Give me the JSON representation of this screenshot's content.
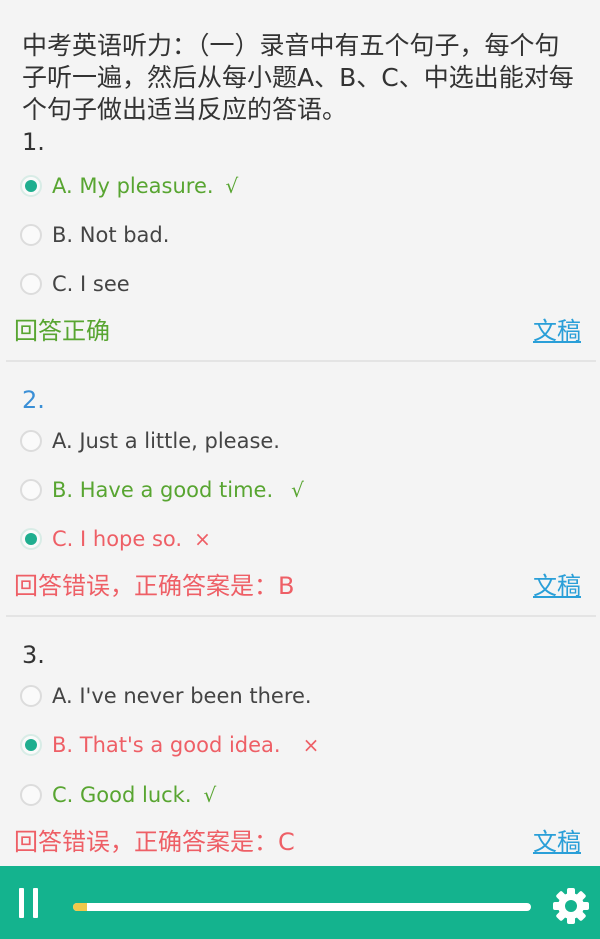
{
  "intro": "中考英语听力：（一）录音中有五个句子，每个句子听一遍，然后从每小题A、B、C、中选出能对每个句子做出适当反应的答语。",
  "questions": [
    {
      "number": "1.",
      "options": [
        {
          "text": "A. My pleasure.",
          "mark": "√",
          "status": "correct",
          "selected": true
        },
        {
          "text": "B. Not bad.",
          "mark": "",
          "status": "normal",
          "selected": false
        },
        {
          "text": "C. I see",
          "mark": "",
          "status": "normal",
          "selected": false
        }
      ],
      "result": "回答正确",
      "result_status": "correct",
      "script_link": "文稿"
    },
    {
      "number": "2.",
      "options": [
        {
          "text": "A. Just a little, please.",
          "mark": "",
          "status": "normal",
          "selected": false
        },
        {
          "text": "B. Have a good time.",
          "mark": "√",
          "status": "correct",
          "selected": false
        },
        {
          "text": "C. I hope so.",
          "mark": "×",
          "status": "wrong",
          "selected": true
        }
      ],
      "result": "回答错误，正确答案是：B",
      "result_status": "wrong",
      "script_link": "文稿"
    },
    {
      "number": "3.",
      "options": [
        {
          "text": "A. I've never been there.",
          "mark": "",
          "status": "normal",
          "selected": false
        },
        {
          "text": "B. That's a good idea.",
          "mark": "×",
          "status": "wrong",
          "selected": true
        },
        {
          "text": "C. Good luck.",
          "mark": "√",
          "status": "correct",
          "selected": false
        }
      ],
      "result": "回答错误，正确答案是：C",
      "result_status": "wrong",
      "script_link": "文稿"
    }
  ],
  "player": {
    "play_state_icon": "pause-icon",
    "settings_icon": "gear-icon",
    "progress": 0.03
  },
  "colors": {
    "accent": "#14b38e",
    "correct": "#58a531",
    "wrong": "#ee5f66",
    "link": "#2a9fd8"
  }
}
